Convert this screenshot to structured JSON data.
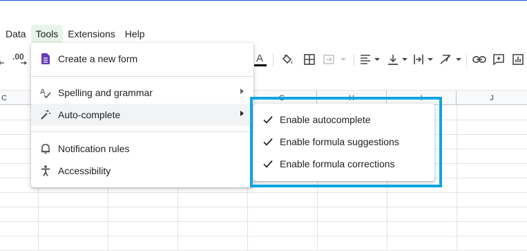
{
  "menubar": {
    "items": [
      {
        "label": "Data"
      },
      {
        "label": "Tools"
      },
      {
        "label": "Extensions"
      },
      {
        "label": "Help"
      }
    ],
    "active": "Tools"
  },
  "toolbar": {
    "decimal_increase_label": ".00",
    "text_color_letter": "A",
    "icons": [
      "decimal-decrease-icon",
      "decimal-increase-icon",
      "text-color-icon",
      "fill-color-icon",
      "borders-icon",
      "merge-cells-icon",
      "horizontal-align-icon",
      "vertical-align-icon",
      "text-wrap-icon",
      "text-rotation-icon",
      "link-icon",
      "comment-icon",
      "chart-icon"
    ]
  },
  "grid": {
    "columns": [
      "C",
      "",
      "",
      "",
      "G",
      "H",
      "I",
      "J"
    ]
  },
  "tools_menu": {
    "items": [
      {
        "label": "Create a new form",
        "icon": "forms-icon",
        "submenu": false
      },
      {
        "label": "Spelling and grammar",
        "icon": "spellcheck-icon",
        "submenu": true
      },
      {
        "label": "Auto-complete",
        "icon": "magic-wand-icon",
        "submenu": true,
        "hovered": true
      },
      {
        "label": "Notification rules",
        "icon": "bell-icon",
        "submenu": false
      },
      {
        "label": "Accessibility",
        "icon": "accessibility-icon",
        "submenu": false
      }
    ]
  },
  "autocomplete_submenu": {
    "items": [
      {
        "label": "Enable autocomplete",
        "checked": true
      },
      {
        "label": "Enable formula suggestions",
        "checked": true
      },
      {
        "label": "Enable formula corrections",
        "checked": true
      }
    ]
  },
  "colors": {
    "accent": "#1a73e8",
    "highlight_box": "#0ea5e0",
    "forms_purple": "#673ab7",
    "menu_hover": "#f1f3f4",
    "active_menu": "#e6f4ea"
  }
}
